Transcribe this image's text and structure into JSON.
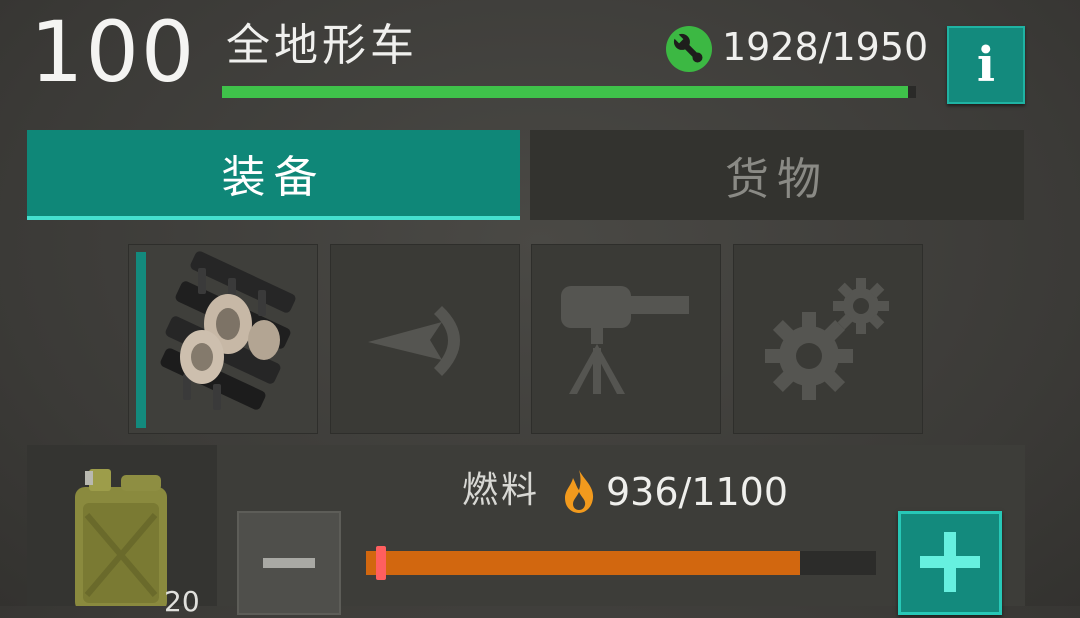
{
  "header": {
    "level": "100",
    "vehicle_name": "全地形车",
    "durability_text": "1928/1950",
    "durability": {
      "current": 1928,
      "max": 1950
    },
    "info_label": "i"
  },
  "tabs": [
    {
      "label": "装备",
      "active": true
    },
    {
      "label": "货物",
      "active": false
    }
  ],
  "slots": [
    {
      "icon": "tank-tracks-icon",
      "equipped": true
    },
    {
      "icon": "boost-arrow-icon",
      "equipped": false
    },
    {
      "icon": "turret-icon",
      "equipped": false
    },
    {
      "icon": "gears-icon",
      "equipped": false
    }
  ],
  "fuel": {
    "label": "燃料",
    "value_text": "936/1100",
    "current": 936,
    "max": 1100,
    "selected_fraction": 0.02,
    "canister_count": "20",
    "icon": "fuel-canister-icon",
    "flame_icon": "flame-icon"
  },
  "colors": {
    "accent": "#138a7d",
    "durability": "#3fc24a",
    "fuel": "#d2670f",
    "handle": "#ff5f5f"
  }
}
